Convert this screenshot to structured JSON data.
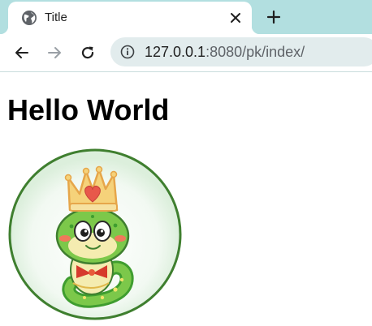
{
  "browser": {
    "tab": {
      "title": "Title",
      "favicon": "globe-icon",
      "close_icon": "close-icon"
    },
    "new_tab_icon": "plus-icon",
    "nav": {
      "back_icon": "arrow-left-icon",
      "forward_icon": "arrow-right-icon",
      "reload_icon": "reload-icon"
    },
    "address": {
      "info_icon": "info-icon",
      "host": "127.0.0.1",
      "rest": ":8080/pk/index/"
    },
    "colors": {
      "tabstrip": "#b2dfe0",
      "omnibox": "#e2eced"
    }
  },
  "page": {
    "heading": "Hello World",
    "logo": "snake-king-logo"
  }
}
